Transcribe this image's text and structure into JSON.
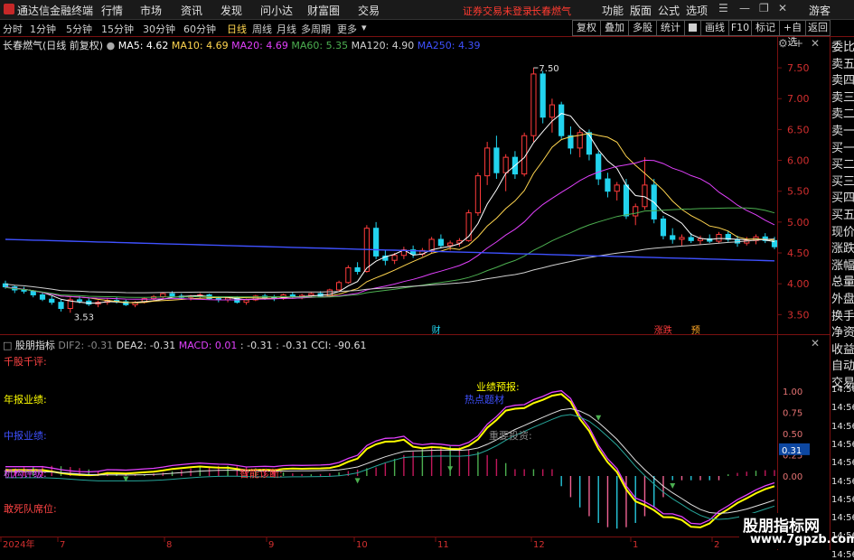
{
  "window": {
    "title": "通达信金融终端",
    "menus": [
      "行情",
      "市场",
      "资讯",
      "发现",
      "问小达",
      "财富圈",
      "交易"
    ],
    "notice": "证券交易未登录",
    "stock_name_top": "长春燃气",
    "right_menus": [
      "功能",
      "版面",
      "公式",
      "选项"
    ],
    "guest": "游客"
  },
  "periods": {
    "tabs": [
      "分时",
      "1分钟",
      "5分钟",
      "15分钟",
      "30分钟",
      "60分钟",
      "日线",
      "周线",
      "月线",
      "多周期",
      "更多"
    ],
    "active": "日线",
    "tools": [
      "复权",
      "叠加",
      "多股",
      "统计",
      "画线",
      "F10",
      "标记",
      "+自选",
      "返回"
    ]
  },
  "right_panel": {
    "items": [
      "委比",
      "卖五",
      "卖四",
      "卖三",
      "卖二",
      "卖一",
      "买一",
      "买二",
      "买三",
      "买四",
      "买五",
      "现价",
      "涨跌",
      "涨幅",
      "总量",
      "外盘",
      "换手",
      "净资",
      "收益",
      "自动",
      "交易"
    ],
    "small_values": [
      "1.00",
      "0.75",
      "0.50",
      "0.25",
      "0.00",
      "0.31"
    ],
    "times": [
      "14:56",
      "14:56",
      "14:56",
      "14:56",
      "14:56",
      "14:56",
      "14:56",
      "14:56",
      "14:56",
      "14:56"
    ]
  },
  "main_legend": {
    "name": "长春燃气(日线 前复权)",
    "ma": [
      {
        "label": "MA5: 4.62",
        "color": "#ffffff"
      },
      {
        "label": "MA10: 4.69",
        "color": "#ffd54f"
      },
      {
        "label": "MA20: 4.69",
        "color": "#e040fb"
      },
      {
        "label": "MA60: 5.35",
        "color": "#4caf50"
      },
      {
        "label": "MA120: 4.90",
        "color": "#cfcfcf"
      },
      {
        "label": "MA250: 4.39",
        "color": "#3f51ff"
      }
    ]
  },
  "indicator_legend": {
    "name": "股朋指标",
    "items": [
      {
        "label": "DIF2: -0.31",
        "color": "#888888"
      },
      {
        "label": "DEA2: -0.31",
        "color": "#dddddd"
      },
      {
        "label": "MACD: 0.01",
        "color": "#e040fb"
      },
      {
        "label": ": -0.31",
        "color": "#dddddd"
      },
      {
        "label": ": -0.31",
        "color": "#dddddd"
      },
      {
        "label": "CCI: -90.61",
        "color": "#dddddd"
      }
    ]
  },
  "indicator_labels": [
    {
      "text": "千股千评:",
      "color": "#ff4444"
    },
    {
      "text": "年报业绩:",
      "color": "#ffff00"
    },
    {
      "text": "中报业绩:",
      "color": "#3f51ff"
    },
    {
      "text": "机构评级:",
      "color": "#e040fb"
    },
    {
      "text": "敢死队席位:",
      "color": "#ff4444"
    },
    {
      "text": "业绩预报:",
      "color": "#ffff00"
    },
    {
      "text": "智能诊断:",
      "color": "#ff4444"
    },
    {
      "text": "热点题材",
      "color": "#3f51ff"
    },
    {
      "text": "重要投资:",
      "color": "#888888"
    }
  ],
  "chart_data": {
    "type": "candlestick",
    "title": "长春燃气(日线 前复权)",
    "price_axis": {
      "ticks": [
        7.5,
        7.0,
        6.5,
        6.0,
        5.5,
        5.0,
        4.5,
        4.0,
        3.5
      ],
      "ylim": [
        3.3,
        7.75
      ]
    },
    "indicator_axis": {
      "ticks": [
        "1.00",
        "0.75",
        "0.50",
        "0.25",
        "0.00"
      ],
      "current": "0.31"
    },
    "x_ticks": [
      "2024年",
      "7",
      "8",
      "9",
      "10",
      "11",
      "12",
      "1",
      "2"
    ],
    "annotations": [
      {
        "text": "7.50",
        "value": 7.5
      },
      {
        "text": "3.53",
        "value": 3.53
      }
    ],
    "event_marks": [
      "财",
      "涨跌",
      "预"
    ],
    "ohlc_approx": [
      [
        4.0,
        4.05,
        3.92,
        3.95
      ],
      [
        3.95,
        3.98,
        3.85,
        3.9
      ],
      [
        3.9,
        3.95,
        3.84,
        3.88
      ],
      [
        3.88,
        3.9,
        3.78,
        3.82
      ],
      [
        3.82,
        3.86,
        3.72,
        3.75
      ],
      [
        3.75,
        3.8,
        3.66,
        3.7
      ],
      [
        3.7,
        3.74,
        3.55,
        3.6
      ],
      [
        3.6,
        3.78,
        3.53,
        3.74
      ],
      [
        3.74,
        3.8,
        3.68,
        3.72
      ],
      [
        3.72,
        3.76,
        3.64,
        3.67
      ],
      [
        3.67,
        3.73,
        3.62,
        3.7
      ],
      [
        3.7,
        3.76,
        3.66,
        3.73
      ],
      [
        3.73,
        3.78,
        3.68,
        3.71
      ],
      [
        3.71,
        3.74,
        3.64,
        3.66
      ],
      [
        3.66,
        3.72,
        3.62,
        3.7
      ],
      [
        3.7,
        3.78,
        3.68,
        3.76
      ],
      [
        3.76,
        3.82,
        3.72,
        3.79
      ],
      [
        3.79,
        3.86,
        3.75,
        3.84
      ],
      [
        3.84,
        3.88,
        3.78,
        3.8
      ],
      [
        3.8,
        3.84,
        3.74,
        3.78
      ],
      [
        3.78,
        3.82,
        3.73,
        3.8
      ],
      [
        3.8,
        3.85,
        3.76,
        3.82
      ],
      [
        3.82,
        3.84,
        3.74,
        3.76
      ],
      [
        3.76,
        3.8,
        3.7,
        3.74
      ],
      [
        3.74,
        3.79,
        3.7,
        3.77
      ],
      [
        3.77,
        3.8,
        3.68,
        3.7
      ],
      [
        3.7,
        3.76,
        3.66,
        3.74
      ],
      [
        3.74,
        3.82,
        3.72,
        3.8
      ],
      [
        3.8,
        3.84,
        3.74,
        3.78
      ],
      [
        3.78,
        3.82,
        3.72,
        3.76
      ],
      [
        3.76,
        3.84,
        3.74,
        3.82
      ],
      [
        3.82,
        3.86,
        3.76,
        3.79
      ],
      [
        3.79,
        3.84,
        3.75,
        3.81
      ],
      [
        3.81,
        3.86,
        3.78,
        3.84
      ],
      [
        3.84,
        3.88,
        3.78,
        3.8
      ],
      [
        3.8,
        3.92,
        3.78,
        3.9
      ],
      [
        3.9,
        4.05,
        3.88,
        4.02
      ],
      [
        4.02,
        4.3,
        4.0,
        4.26
      ],
      [
        4.26,
        4.35,
        4.15,
        4.2
      ],
      [
        4.2,
        4.95,
        4.18,
        4.9
      ],
      [
        4.9,
        5.0,
        4.4,
        4.45
      ],
      [
        4.45,
        4.55,
        4.3,
        4.38
      ],
      [
        4.38,
        4.5,
        4.32,
        4.46
      ],
      [
        4.46,
        4.6,
        4.4,
        4.55
      ],
      [
        4.55,
        4.62,
        4.42,
        4.48
      ],
      [
        4.48,
        4.58,
        4.44,
        4.54
      ],
      [
        4.54,
        4.76,
        4.5,
        4.72
      ],
      [
        4.72,
        4.8,
        4.58,
        4.62
      ],
      [
        4.62,
        4.7,
        4.54,
        4.66
      ],
      [
        4.66,
        4.74,
        4.6,
        4.7
      ],
      [
        4.7,
        5.2,
        4.68,
        5.15
      ],
      [
        5.15,
        5.8,
        5.1,
        5.75
      ],
      [
        5.75,
        6.3,
        5.6,
        6.2
      ],
      [
        6.2,
        6.4,
        5.7,
        5.8
      ],
      [
        5.8,
        6.1,
        5.5,
        6.05
      ],
      [
        6.05,
        6.15,
        5.7,
        5.78
      ],
      [
        5.78,
        6.45,
        5.74,
        6.4
      ],
      [
        6.4,
        7.5,
        6.3,
        7.4
      ],
      [
        7.4,
        7.45,
        6.6,
        6.7
      ],
      [
        6.7,
        7.0,
        6.45,
        6.9
      ],
      [
        6.9,
        6.95,
        6.35,
        6.4
      ],
      [
        6.4,
        6.55,
        6.1,
        6.2
      ],
      [
        6.2,
        6.5,
        6.05,
        6.45
      ],
      [
        6.45,
        6.5,
        6.0,
        6.1
      ],
      [
        6.1,
        6.15,
        5.6,
        5.7
      ],
      [
        5.7,
        5.8,
        5.4,
        5.5
      ],
      [
        5.5,
        5.65,
        5.35,
        5.6
      ],
      [
        5.6,
        5.7,
        5.05,
        5.1
      ],
      [
        5.1,
        5.3,
        4.95,
        5.25
      ],
      [
        5.25,
        6.05,
        5.2,
        5.6
      ],
      [
        5.6,
        5.7,
        4.98,
        5.05
      ],
      [
        5.05,
        5.1,
        4.72,
        4.78
      ],
      [
        4.78,
        4.9,
        4.65,
        4.72
      ],
      [
        4.72,
        4.8,
        4.62,
        4.75
      ],
      [
        4.75,
        4.82,
        4.66,
        4.7
      ],
      [
        4.7,
        4.78,
        4.64,
        4.73
      ],
      [
        4.73,
        4.8,
        4.66,
        4.69
      ],
      [
        4.69,
        4.84,
        4.66,
        4.8
      ],
      [
        4.8,
        4.86,
        4.68,
        4.72
      ],
      [
        4.72,
        4.78,
        4.6,
        4.66
      ],
      [
        4.66,
        4.76,
        4.62,
        4.7
      ],
      [
        4.7,
        4.8,
        4.64,
        4.76
      ],
      [
        4.76,
        4.82,
        4.66,
        4.7
      ],
      [
        4.7,
        4.76,
        4.56,
        4.6
      ]
    ],
    "series_lines": [
      {
        "name": "MA5",
        "color": "#ffffff"
      },
      {
        "name": "MA10",
        "color": "#ffd54f"
      },
      {
        "name": "MA20",
        "color": "#e040fb"
      },
      {
        "name": "MA60",
        "color": "#4caf50"
      },
      {
        "name": "MA120",
        "color": "#cfcfcf"
      },
      {
        "name": "MA250",
        "color": "#3f51ff"
      }
    ]
  },
  "watermark": {
    "line1": "股朋指标网",
    "line2": "www.7gpzb.com"
  }
}
